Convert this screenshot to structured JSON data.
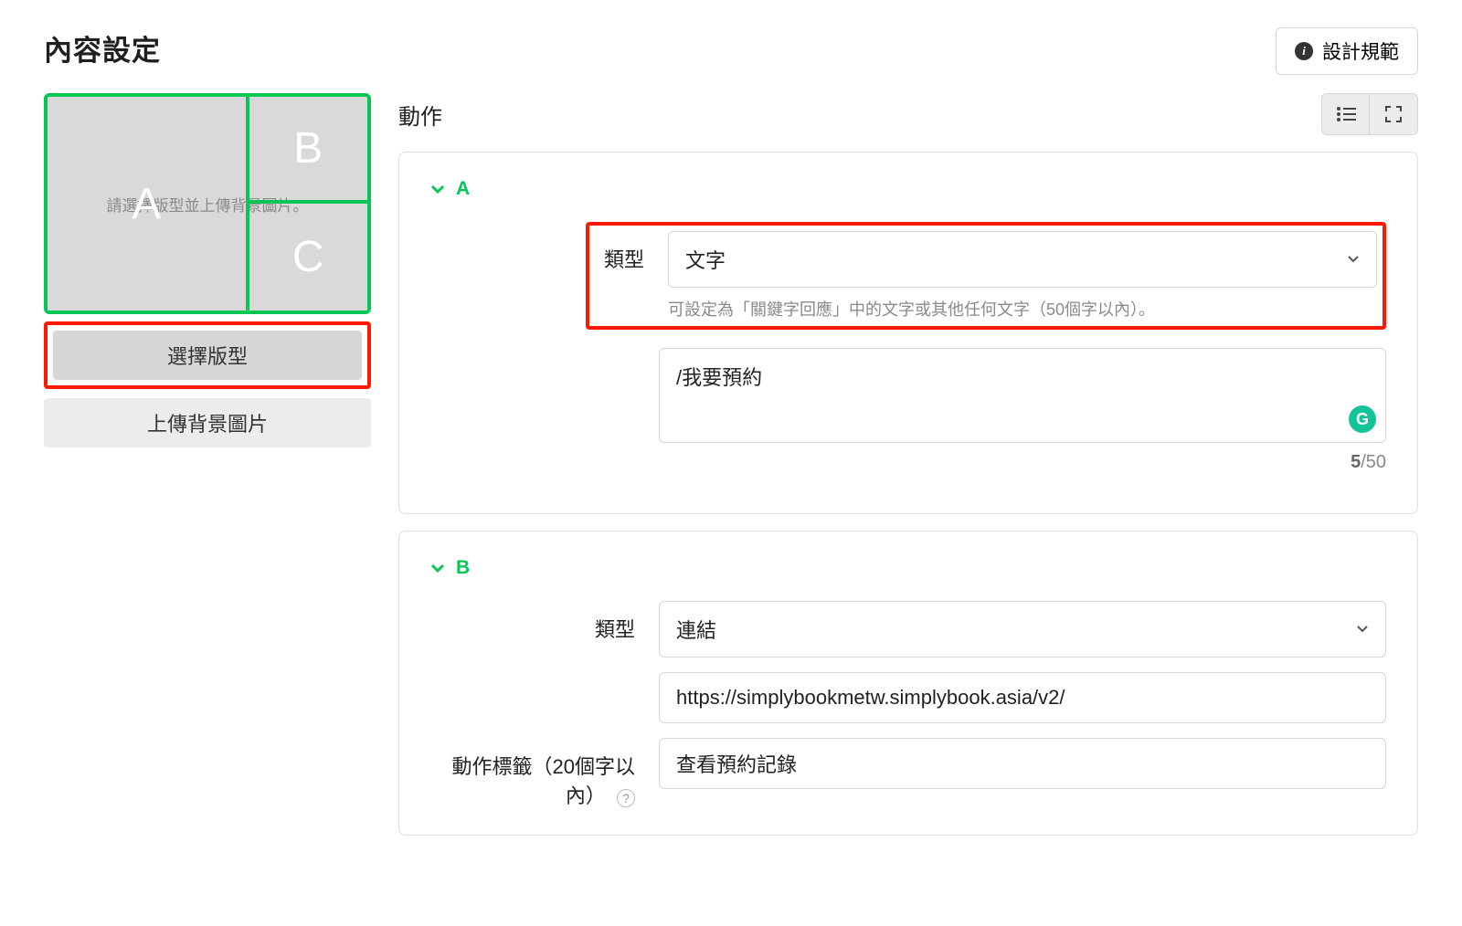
{
  "page_title": "內容設定",
  "design_guide_label": "設計規範",
  "preview": {
    "hint": "請選擇版型並上傳背景圖片。",
    "cells": {
      "a": "A",
      "b": "B",
      "c": "C"
    }
  },
  "left_buttons": {
    "choose_template": "選擇版型",
    "upload_bg": "上傳背景圖片"
  },
  "right": {
    "section_title": "動作",
    "panels": [
      {
        "key": "A",
        "type_label": "類型",
        "type_value": "文字",
        "type_hint": "可設定為「關鍵字回應」中的文字或其他任何文字（50個字以內）。",
        "text_value": "/我要預約",
        "char_current": "5",
        "char_max": "/50"
      },
      {
        "key": "B",
        "type_label": "類型",
        "type_value": "連結",
        "url_value": "https://simplybookmetw.simplybook.asia/v2/",
        "action_label_label": "動作標籤（20個字以內）",
        "action_label_value": "查看預約記錄"
      }
    ]
  }
}
